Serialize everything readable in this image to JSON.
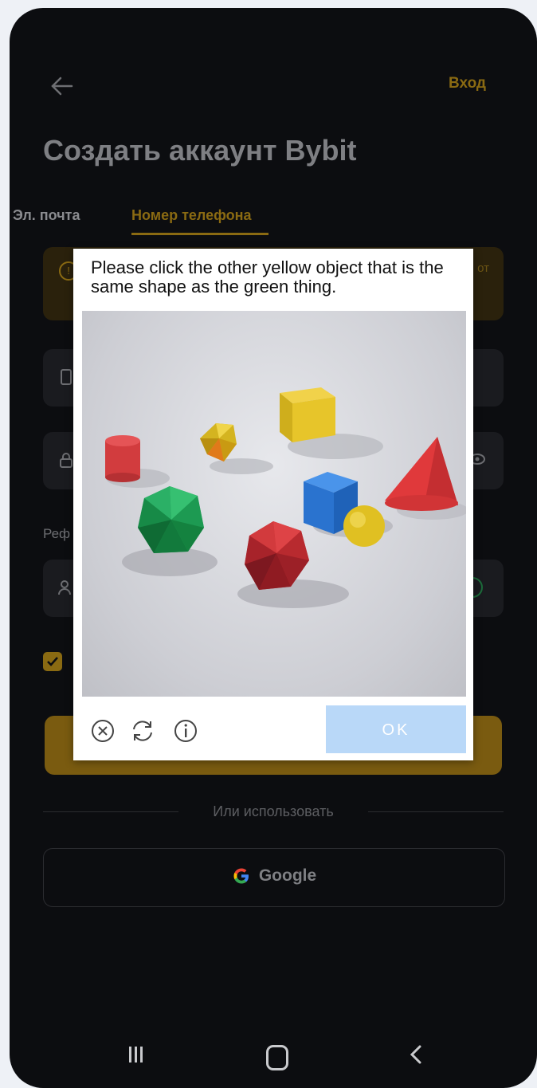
{
  "header": {
    "login_label": "Вход",
    "title": "Создать аккаунт Bybit"
  },
  "tabs": {
    "email_label": "Эл. почта",
    "phone_label": "Номер телефона"
  },
  "notice": {
    "trailing_text": "от"
  },
  "referral": {
    "label": "Реф"
  },
  "divider": {
    "or_text": "Или использовать"
  },
  "social": {
    "google_label": "Google"
  },
  "captcha": {
    "prompt": "Please click the other yellow object that is the same shape as the green thing.",
    "ok_label": "OK",
    "tools": [
      "close-icon",
      "refresh-icon",
      "info-icon"
    ]
  },
  "colors": {
    "accent": "#f7a600",
    "dialog_ok": "#b9d8f8",
    "background": "#0c0d10"
  }
}
